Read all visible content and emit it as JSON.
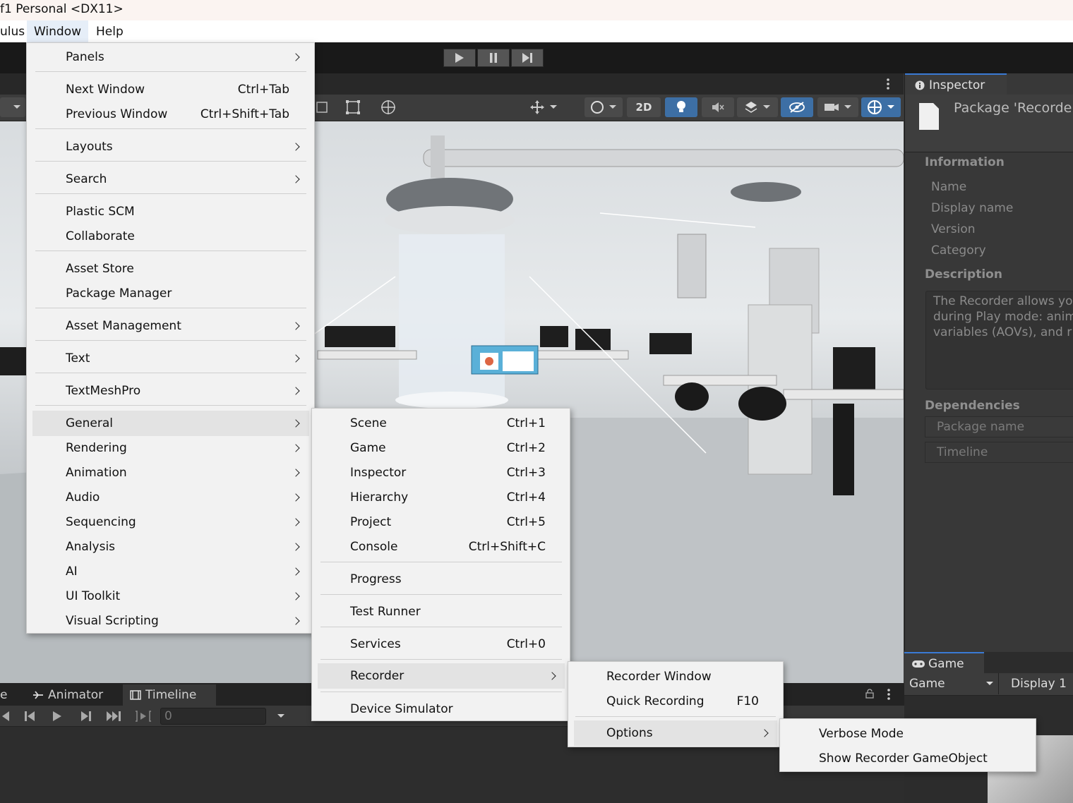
{
  "window": {
    "title": "f1 Personal <DX11>"
  },
  "menubar": {
    "items": [
      "ulus",
      "Window",
      "Help"
    ]
  },
  "window_menu": {
    "items": [
      {
        "label": "Panels",
        "submenu": true
      },
      {
        "label": "Next Window",
        "shortcut": "Ctrl+Tab"
      },
      {
        "label": "Previous Window",
        "shortcut": "Ctrl+Shift+Tab"
      },
      {
        "label": "Layouts",
        "submenu": true
      },
      {
        "label": "Search",
        "submenu": true
      },
      {
        "label": "Plastic SCM"
      },
      {
        "label": "Collaborate"
      },
      {
        "label": "Asset Store"
      },
      {
        "label": "Package Manager"
      },
      {
        "label": "Asset Management",
        "submenu": true
      },
      {
        "label": "Text",
        "submenu": true
      },
      {
        "label": "TextMeshPro",
        "submenu": true
      },
      {
        "label": "General",
        "submenu": true,
        "highlighted": true
      },
      {
        "label": "Rendering",
        "submenu": true
      },
      {
        "label": "Animation",
        "submenu": true
      },
      {
        "label": "Audio",
        "submenu": true
      },
      {
        "label": "Sequencing",
        "submenu": true
      },
      {
        "label": "Analysis",
        "submenu": true
      },
      {
        "label": "AI",
        "submenu": true
      },
      {
        "label": "UI Toolkit",
        "submenu": true
      },
      {
        "label": "Visual Scripting",
        "submenu": true
      }
    ]
  },
  "general_menu": {
    "items": [
      {
        "label": "Scene",
        "shortcut": "Ctrl+1"
      },
      {
        "label": "Game",
        "shortcut": "Ctrl+2"
      },
      {
        "label": "Inspector",
        "shortcut": "Ctrl+3"
      },
      {
        "label": "Hierarchy",
        "shortcut": "Ctrl+4"
      },
      {
        "label": "Project",
        "shortcut": "Ctrl+5"
      },
      {
        "label": "Console",
        "shortcut": "Ctrl+Shift+C"
      },
      {
        "label": "Progress"
      },
      {
        "label": "Test Runner"
      },
      {
        "label": "Services",
        "shortcut": "Ctrl+0"
      },
      {
        "label": "Recorder",
        "submenu": true,
        "highlighted": true
      },
      {
        "label": "Device Simulator"
      }
    ]
  },
  "recorder_menu": {
    "items": [
      {
        "label": "Recorder Window"
      },
      {
        "label": "Quick Recording",
        "shortcut": "F10"
      },
      {
        "label": "Options",
        "submenu": true,
        "highlighted": true
      }
    ]
  },
  "options_menu": {
    "items": [
      {
        "label": "Verbose Mode"
      },
      {
        "label": "Show Recorder GameObject"
      }
    ]
  },
  "scene_toolbar": {
    "mode_2d": "2D"
  },
  "inspector": {
    "tab": "Inspector",
    "package_title": "Package 'Recorde",
    "information_header": "Information",
    "fields": [
      "Name",
      "Display name",
      "Version",
      "Category"
    ],
    "description_header": "Description",
    "description": "The Recorder allows yo\nduring Play mode: anim\nvariables (AOVs), and r",
    "dependencies_header": "Dependencies",
    "dependencies_columns": [
      "Package name"
    ],
    "dependencies_rows": [
      "Timeline"
    ]
  },
  "game_panel": {
    "tab": "Game",
    "view_select": "Game",
    "display_select": "Display 1"
  },
  "bottom_panel": {
    "tabs": [
      "e",
      "Animator",
      "Timeline"
    ],
    "frame_value": "0"
  },
  "colors": {
    "accent": "#3a7ad5",
    "menu_bg": "#f2f2f2",
    "menu_highlight": "#e3e3e3",
    "editor_bg": "#383838"
  }
}
